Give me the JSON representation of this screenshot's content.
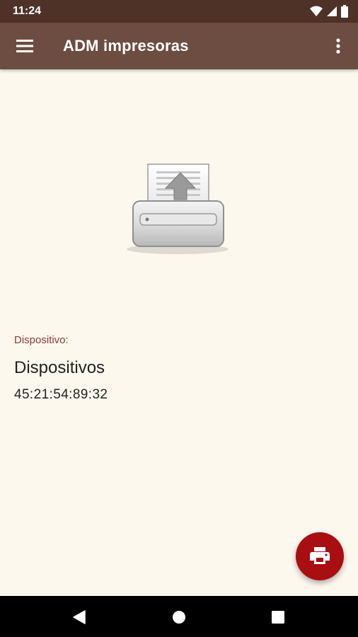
{
  "status_bar": {
    "time": "11:24",
    "icons": [
      "wifi-icon",
      "signal-icon",
      "battery-icon"
    ]
  },
  "app_bar": {
    "title": "ADM impresoras",
    "menu_icon": "hamburger-menu-icon",
    "overflow_icon": "more-vert-icon"
  },
  "main": {
    "illustration": "printer-icon",
    "device_caption": "Dispositivo:",
    "device_name": "Dispositivos",
    "device_address": "45:21:54:89:32"
  },
  "fab": {
    "icon": "print-icon"
  },
  "nav_bar": {
    "icons": [
      "back-icon",
      "home-icon",
      "recents-icon"
    ]
  },
  "colors": {
    "status_bar": "#4e3228",
    "app_bar": "#6d4c41",
    "background": "#fdf8ee",
    "caption": "#8d3b36",
    "fab": "#a80e12"
  }
}
